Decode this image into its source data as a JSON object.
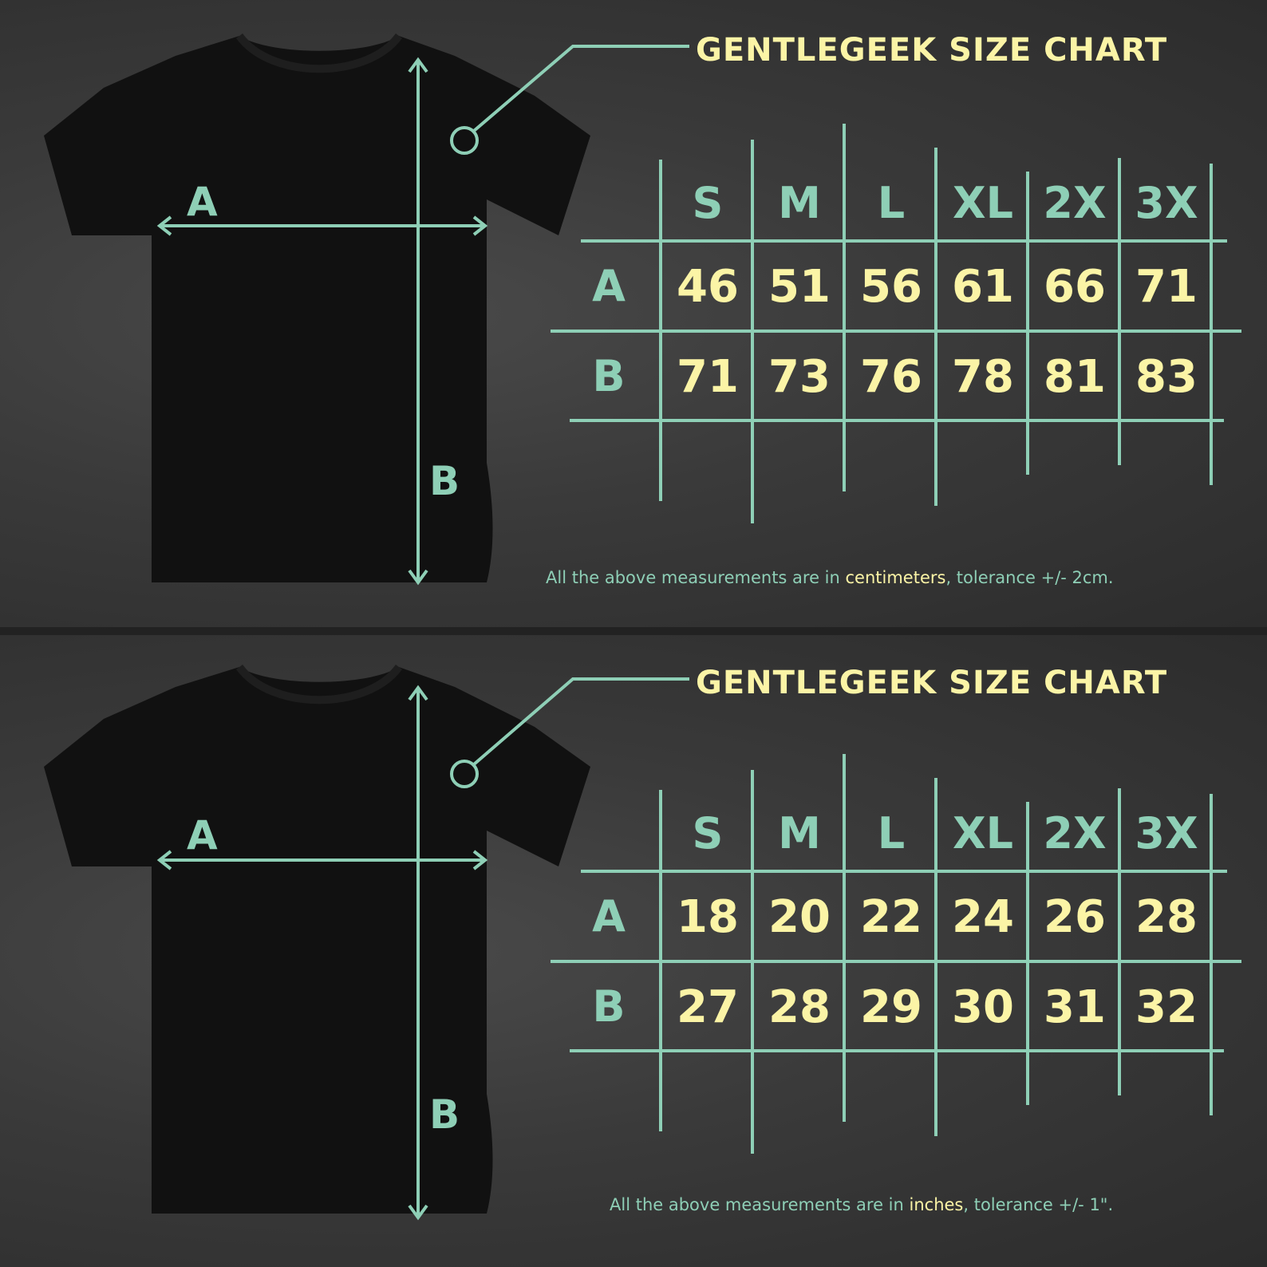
{
  "charts": [
    {
      "title": "GENTLEGEEK SIZE CHART",
      "dimension_labels": {
        "a": "A",
        "b": "B"
      },
      "sizes": [
        "S",
        "M",
        "L",
        "XL",
        "2X",
        "3X"
      ],
      "rows": [
        {
          "label": "A",
          "values": [
            "46",
            "51",
            "56",
            "61",
            "66",
            "71"
          ]
        },
        {
          "label": "B",
          "values": [
            "71",
            "73",
            "76",
            "78",
            "81",
            "83"
          ]
        }
      ],
      "note": {
        "prefix": "All the above measurements are in ",
        "unit": "centimeters",
        "suffix": ", tolerance +/- 2cm."
      }
    },
    {
      "title": "GENTLEGEEK SIZE CHART",
      "dimension_labels": {
        "a": "A",
        "b": "B"
      },
      "sizes": [
        "S",
        "M",
        "L",
        "XL",
        "2X",
        "3X"
      ],
      "rows": [
        {
          "label": "A",
          "values": [
            "18",
            "20",
            "22",
            "24",
            "26",
            "28"
          ]
        },
        {
          "label": "B",
          "values": [
            "27",
            "28",
            "29",
            "30",
            "31",
            "32"
          ]
        }
      ],
      "note": {
        "prefix": "All the above measurements are in ",
        "unit": "inches",
        "suffix": ", tolerance +/- 1\"."
      }
    }
  ],
  "colors": {
    "accent": "#8ecfb6",
    "highlight": "#fbf4a6",
    "shirt": "#111111",
    "background": "#3a3a3a"
  },
  "icons": {
    "shirt": "t-shirt-illustration",
    "pointer": "callout-circle"
  }
}
